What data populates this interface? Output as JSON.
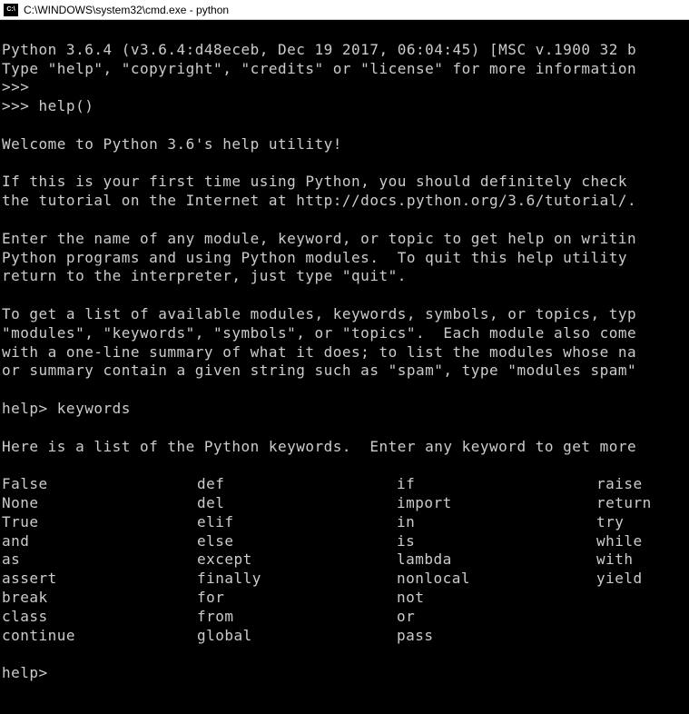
{
  "window": {
    "title": "C:\\WINDOWS\\system32\\cmd.exe - python"
  },
  "terminal": {
    "banner_line1": "Python 3.6.4 (v3.6.4:d48eceb, Dec 19 2017, 06:04:45) [MSC v.1900 32 b",
    "banner_line2": "Type \"help\", \"copyright\", \"credits\" or \"license\" for more information",
    "prompt1": ">>>",
    "prompt2": ">>> help()",
    "welcome": "Welcome to Python 3.6's help utility!",
    "para1_line1": "If this is your first time using Python, you should definitely check ",
    "para1_line2": "the tutorial on the Internet at http://docs.python.org/3.6/tutorial/.",
    "para2_line1": "Enter the name of any module, keyword, or topic to get help on writin",
    "para2_line2": "Python programs and using Python modules.  To quit this help utility ",
    "para2_line3": "return to the interpreter, just type \"quit\".",
    "para3_line1": "To get a list of available modules, keywords, symbols, or topics, typ",
    "para3_line2": "\"modules\", \"keywords\", \"symbols\", or \"topics\".  Each module also come",
    "para3_line3": "with a one-line summary of what it does; to list the modules whose na",
    "para3_line4": "or summary contain a given string such as \"spam\", type \"modules spam\"",
    "help_prompt1": "help> keywords",
    "keywords_intro": "Here is a list of the Python keywords.  Enter any keyword to get more",
    "keywords": {
      "col1": [
        "False",
        "None",
        "True",
        "and",
        "as",
        "assert",
        "break",
        "class",
        "continue"
      ],
      "col2": [
        "def",
        "del",
        "elif",
        "else",
        "except",
        "finally",
        "for",
        "from",
        "global"
      ],
      "col3": [
        "if",
        "import",
        "in",
        "is",
        "lambda",
        "nonlocal",
        "not",
        "or",
        "pass"
      ],
      "col4": [
        "raise",
        "return",
        "try",
        "while",
        "with",
        "yield"
      ]
    },
    "help_prompt2": "help>"
  }
}
